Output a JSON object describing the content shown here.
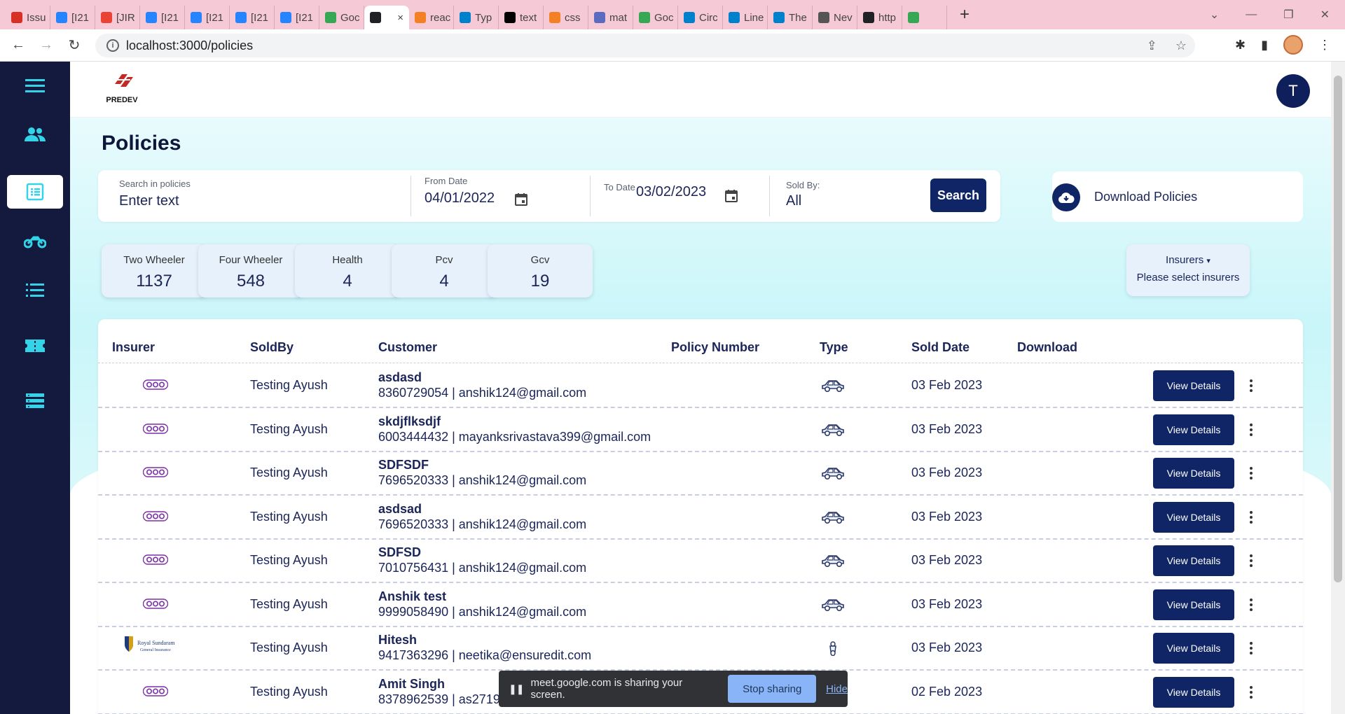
{
  "browser": {
    "tabs": [
      {
        "label": "Issu",
        "color": "#d93025"
      },
      {
        "label": "[I21",
        "color": "#2684ff"
      },
      {
        "label": "[JIR",
        "color": "#ea4335"
      },
      {
        "label": "[I21",
        "color": "#2684ff"
      },
      {
        "label": "[I21",
        "color": "#2684ff"
      },
      {
        "label": "[I21",
        "color": "#2684ff"
      },
      {
        "label": "[I21",
        "color": "#2684ff"
      },
      {
        "label": "Goc",
        "color": "#34a853"
      },
      {
        "label": "×",
        "color": "#202124",
        "active": true
      },
      {
        "label": "reac",
        "color": "#f48024"
      },
      {
        "label": "Typ",
        "color": "#0081cb"
      },
      {
        "label": "text",
        "color": "#000000"
      },
      {
        "label": "css",
        "color": "#f48024"
      },
      {
        "label": "mat",
        "color": "#5c6bc0"
      },
      {
        "label": "Goc",
        "color": "#34a853"
      },
      {
        "label": "Circ",
        "color": "#0081cb"
      },
      {
        "label": "Line",
        "color": "#0081cb"
      },
      {
        "label": "The",
        "color": "#0081cb"
      },
      {
        "label": "Nev",
        "color": "#555555"
      },
      {
        "label": "http",
        "color": "#202124"
      },
      {
        "label": "",
        "color": "#34a853"
      }
    ],
    "url": "localhost:3000/policies"
  },
  "app": {
    "logo_text": "PREDEV",
    "avatar_initial": "T",
    "page_title": "Policies",
    "accent_color": "#0f2565",
    "sidebar_color": "#141a3d",
    "sidebar_icon_color": "#33d4e8"
  },
  "sidebar": {
    "items": [
      {
        "name": "menu-icon"
      },
      {
        "name": "people-icon"
      },
      {
        "name": "policies-icon",
        "active": true
      },
      {
        "name": "motorbike-icon"
      },
      {
        "name": "list-icon"
      },
      {
        "name": "ticket-icon"
      },
      {
        "name": "storage-icon"
      }
    ]
  },
  "filters": {
    "search_label": "Search in policies",
    "search_placeholder": "Enter text",
    "from_label": "From Date",
    "from_value": "04/01/2022",
    "to_label": "To Date",
    "to_value": "03/02/2023",
    "soldby_label": "Sold By:",
    "soldby_value": "All",
    "search_button": "Search"
  },
  "download": {
    "label": "Download Policies"
  },
  "stats": [
    {
      "label": "Two Wheeler",
      "value": "1137"
    },
    {
      "label": "Four Wheeler",
      "value": "548"
    },
    {
      "label": "Health",
      "value": "4"
    },
    {
      "label": "Pcv",
      "value": "4"
    },
    {
      "label": "Gcv",
      "value": "19"
    }
  ],
  "insurers_filter": {
    "label": "Insurers",
    "placeholder": "Please select insurers"
  },
  "table": {
    "headers": [
      "Insurer",
      "SoldBy",
      "Customer",
      "Policy Number",
      "Type",
      "Sold Date",
      "Download"
    ],
    "view_button": "View Details",
    "rows": [
      {
        "insurer": "acko",
        "sold_by": "Testing Ayush",
        "customer_name": "asdasd",
        "customer_contact": "8360729054 | anshik124@gmail.com",
        "type": "car",
        "sold_date": "03 Feb 2023"
      },
      {
        "insurer": "acko",
        "sold_by": "Testing Ayush",
        "customer_name": "skdjflksdjf",
        "customer_contact": "6003444432 | mayanksrivastava399@gmail.com",
        "type": "car",
        "sold_date": "03 Feb 2023"
      },
      {
        "insurer": "acko",
        "sold_by": "Testing Ayush",
        "customer_name": "SDFSDF",
        "customer_contact": "7696520333 | anshik124@gmail.com",
        "type": "car",
        "sold_date": "03 Feb 2023"
      },
      {
        "insurer": "acko",
        "sold_by": "Testing Ayush",
        "customer_name": "asdsad",
        "customer_contact": "7696520333 | anshik124@gmail.com",
        "type": "car",
        "sold_date": "03 Feb 2023"
      },
      {
        "insurer": "acko",
        "sold_by": "Testing Ayush",
        "customer_name": "SDFSD",
        "customer_contact": "7010756431 | anshik124@gmail.com",
        "type": "car",
        "sold_date": "03 Feb 2023"
      },
      {
        "insurer": "acko",
        "sold_by": "Testing Ayush",
        "customer_name": "Anshik test",
        "customer_contact": "9999058490 | anshik124@gmail.com",
        "type": "car",
        "sold_date": "03 Feb 2023"
      },
      {
        "insurer": "royal-sundaram",
        "sold_by": "Testing Ayush",
        "customer_name": "Hitesh",
        "customer_contact": "9417363296 | neetika@ensuredit.com",
        "type": "two-wheeler",
        "sold_date": "03 Feb 2023"
      },
      {
        "insurer": "acko",
        "sold_by": "Testing Ayush",
        "customer_name": "Amit Singh",
        "customer_contact": "8378962539 | as27199",
        "type": "car",
        "sold_date": "02 Feb 2023"
      }
    ]
  },
  "insurer_logos": {
    "acko": "acko",
    "royal": "Royal Sundaram",
    "royal_sub": "General Insurance"
  },
  "screen_share": {
    "message": "meet.google.com is sharing your screen.",
    "stop_label": "Stop sharing",
    "hide_label": "Hide"
  }
}
